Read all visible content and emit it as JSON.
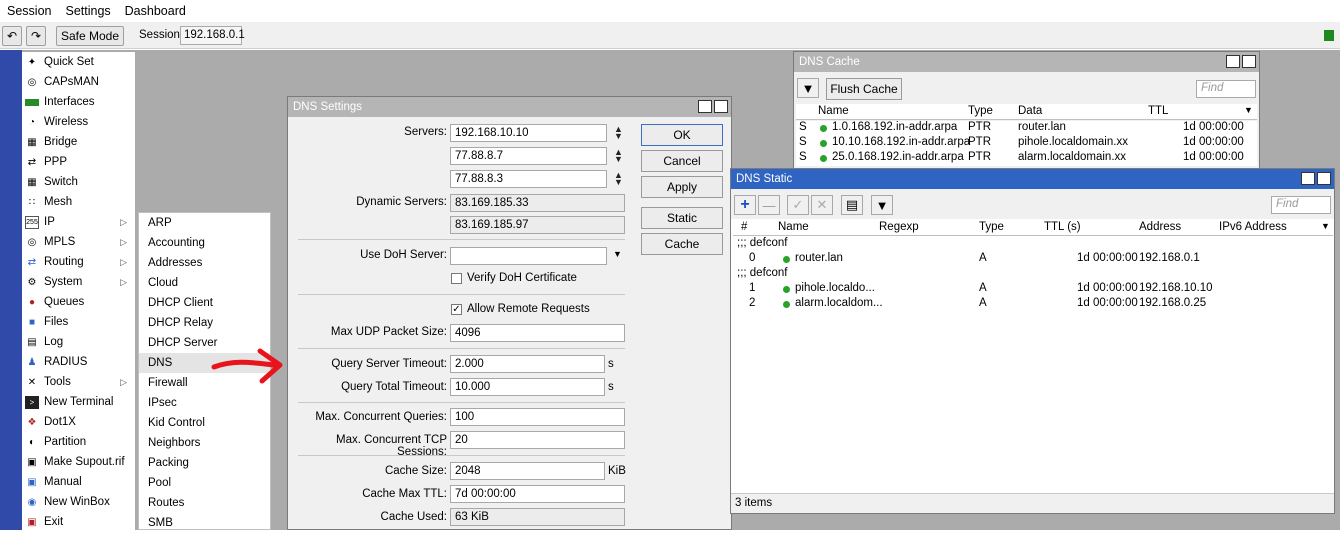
{
  "menu": [
    "Session",
    "Settings",
    "Dashboard"
  ],
  "toolbar": {
    "safe_mode": "Safe Mode",
    "session_label": "Session:",
    "session_value": "192.168.0.1"
  },
  "sidebar": [
    {
      "label": "Quick Set",
      "icon": "wand-icon"
    },
    {
      "label": "CAPsMAN",
      "icon": "capsman-icon"
    },
    {
      "label": "Interfaces",
      "icon": "interfaces-icon"
    },
    {
      "label": "Wireless",
      "icon": "wireless-icon"
    },
    {
      "label": "Bridge",
      "icon": "bridge-icon"
    },
    {
      "label": "PPP",
      "icon": "ppp-icon"
    },
    {
      "label": "Switch",
      "icon": "switch-icon"
    },
    {
      "label": "Mesh",
      "icon": "mesh-icon"
    },
    {
      "label": "IP",
      "icon": "ip-icon",
      "arrow": true
    },
    {
      "label": "MPLS",
      "icon": "mpls-icon",
      "arrow": true
    },
    {
      "label": "Routing",
      "icon": "routing-icon",
      "arrow": true
    },
    {
      "label": "System",
      "icon": "gear-icon",
      "arrow": true
    },
    {
      "label": "Queues",
      "icon": "queues-icon"
    },
    {
      "label": "Files",
      "icon": "folder-icon"
    },
    {
      "label": "Log",
      "icon": "log-icon"
    },
    {
      "label": "RADIUS",
      "icon": "radius-icon"
    },
    {
      "label": "Tools",
      "icon": "tools-icon",
      "arrow": true
    },
    {
      "label": "New Terminal",
      "icon": "terminal-icon"
    },
    {
      "label": "Dot1X",
      "icon": "dot1x-icon"
    },
    {
      "label": "Partition",
      "icon": "partition-icon"
    },
    {
      "label": "Make Supout.rif",
      "icon": "supout-icon"
    },
    {
      "label": "Manual",
      "icon": "manual-icon"
    },
    {
      "label": "New WinBox",
      "icon": "winbox-icon"
    },
    {
      "label": "Exit",
      "icon": "exit-icon"
    }
  ],
  "submenu": [
    "ARP",
    "Accounting",
    "Addresses",
    "Cloud",
    "DHCP Client",
    "DHCP Relay",
    "DHCP Server",
    "DNS",
    "Firewall",
    "IPsec",
    "Kid Control",
    "Neighbors",
    "Packing",
    "Pool",
    "Routes",
    "SMB"
  ],
  "dns_settings": {
    "title": "DNS Settings",
    "servers_label": "Servers:",
    "servers": [
      "192.168.10.10",
      "77.88.8.7",
      "77.88.8.3"
    ],
    "dynamic_label": "Dynamic Servers:",
    "dynamic": [
      "83.169.185.33",
      "83.169.185.97"
    ],
    "doh_label": "Use DoH Server:",
    "doh_value": "",
    "verify_doh": "Verify DoH Certificate",
    "allow_remote": "Allow Remote Requests",
    "max_udp_label": "Max UDP Packet Size:",
    "max_udp": "4096",
    "qst_label": "Query Server Timeout:",
    "qst": "2.000",
    "qtt_label": "Query Total Timeout:",
    "qtt": "10.000",
    "s_unit": "s",
    "mcq_label": "Max. Concurrent Queries:",
    "mcq": "100",
    "mctcp_label": "Max. Concurrent TCP Sessions:",
    "mctcp": "20",
    "cache_size_label": "Cache Size:",
    "cache_size": "2048",
    "kib": "KiB",
    "cache_ttl_label": "Cache Max TTL:",
    "cache_ttl": "7d 00:00:00",
    "cache_used_label": "Cache Used:",
    "cache_used": "63 KiB",
    "buttons": {
      "ok": "OK",
      "cancel": "Cancel",
      "apply": "Apply",
      "static": "Static",
      "cache": "Cache"
    }
  },
  "dns_cache": {
    "title": "DNS Cache",
    "flush": "Flush Cache",
    "find": "Find",
    "headers": {
      "name": "Name",
      "type": "Type",
      "data": "Data",
      "ttl": "TTL"
    },
    "rows": [
      {
        "flag": "S",
        "name": "1.0.168.192.in-addr.arpa",
        "type": "PTR",
        "data": "router.lan",
        "ttl": "1d 00:00:00"
      },
      {
        "flag": "S",
        "name": "10.10.168.192.in-addr.arpa",
        "type": "PTR",
        "data": "pihole.localdomain.xx",
        "ttl": "1d 00:00:00"
      },
      {
        "flag": "S",
        "name": "25.0.168.192.in-addr.arpa",
        "type": "PTR",
        "data": "alarm.localdomain.xx",
        "ttl": "1d 00:00:00"
      }
    ]
  },
  "dns_static": {
    "title": "DNS Static",
    "find": "Find",
    "headers": {
      "num": "#",
      "name": "Name",
      "regexp": "Regexp",
      "type": "Type",
      "ttl": "TTL (s)",
      "address": "Address",
      "ipv6": "IPv6 Address"
    },
    "comment1": ";;; defconf",
    "comment2": ";;; defconf",
    "rows": [
      {
        "num": "0",
        "name": "router.lan",
        "type": "A",
        "ttl": "1d 00:00:00",
        "address": "192.168.0.1"
      },
      {
        "num": "1",
        "name": "pihole.localdo...",
        "type": "A",
        "ttl": "1d 00:00:00",
        "address": "192.168.10.10"
      },
      {
        "num": "2",
        "name": "alarm.localdom...",
        "type": "A",
        "ttl": "1d 00:00:00",
        "address": "192.168.0.25"
      }
    ],
    "status": "3 items"
  }
}
